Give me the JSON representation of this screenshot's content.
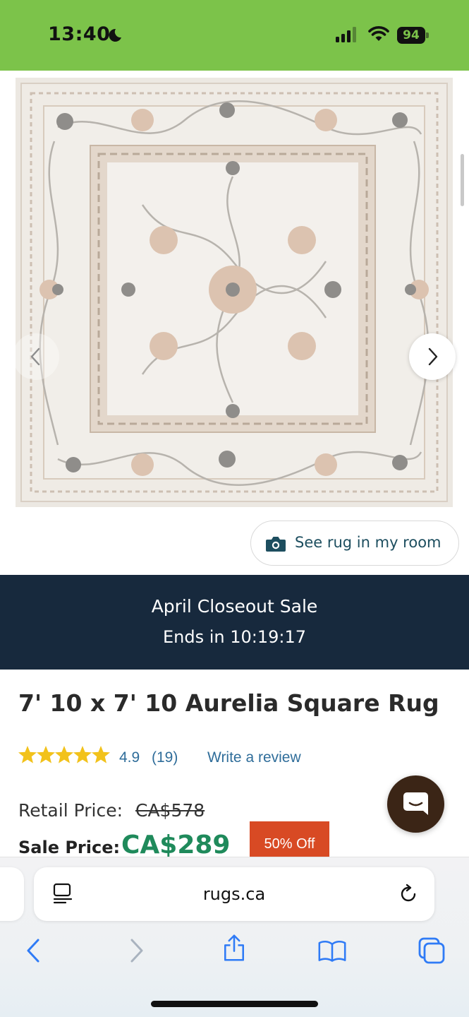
{
  "status_bar": {
    "time": "13:40",
    "battery": "94",
    "background": "#7cc34a"
  },
  "carousel": {
    "prev_icon": "chevron-left-icon",
    "next_icon": "chevron-right-icon",
    "see_rug_label": "See rug in my room"
  },
  "sale_banner": {
    "title": "April Closeout Sale",
    "countdown": "Ends in 10:19:17",
    "background": "#17293d"
  },
  "product": {
    "title": "7' 10 x 7' 10 Aurelia Square Rug",
    "rating": "4.9",
    "rating_stars": 4.9,
    "review_count": "(19)",
    "write_review": "Write a review",
    "retail_label": "Retail Price:",
    "retail_price": "CA$578",
    "sale_label": "Sale Price:",
    "sale_price": "CA$289",
    "discount": "50% Off",
    "colors": {
      "sale_price": "#1f8a5b",
      "discount_badge": "#d84a24",
      "link": "#2f6d9a",
      "star": "#f2c21b"
    }
  },
  "chat": {
    "icon": "chat-bubble-icon",
    "background": "#3b2516"
  },
  "browser": {
    "url": "rugs.ca",
    "reader_icon": "reader-mode-icon",
    "reload_icon": "reload-icon",
    "toolbar": [
      {
        "name": "back",
        "icon": "back-icon"
      },
      {
        "name": "forward",
        "icon": "forward-icon"
      },
      {
        "name": "share",
        "icon": "share-icon"
      },
      {
        "name": "bookmarks",
        "icon": "bookmarks-icon"
      },
      {
        "name": "tabs",
        "icon": "tabs-icon"
      }
    ],
    "accent": "#2f7bf6"
  }
}
